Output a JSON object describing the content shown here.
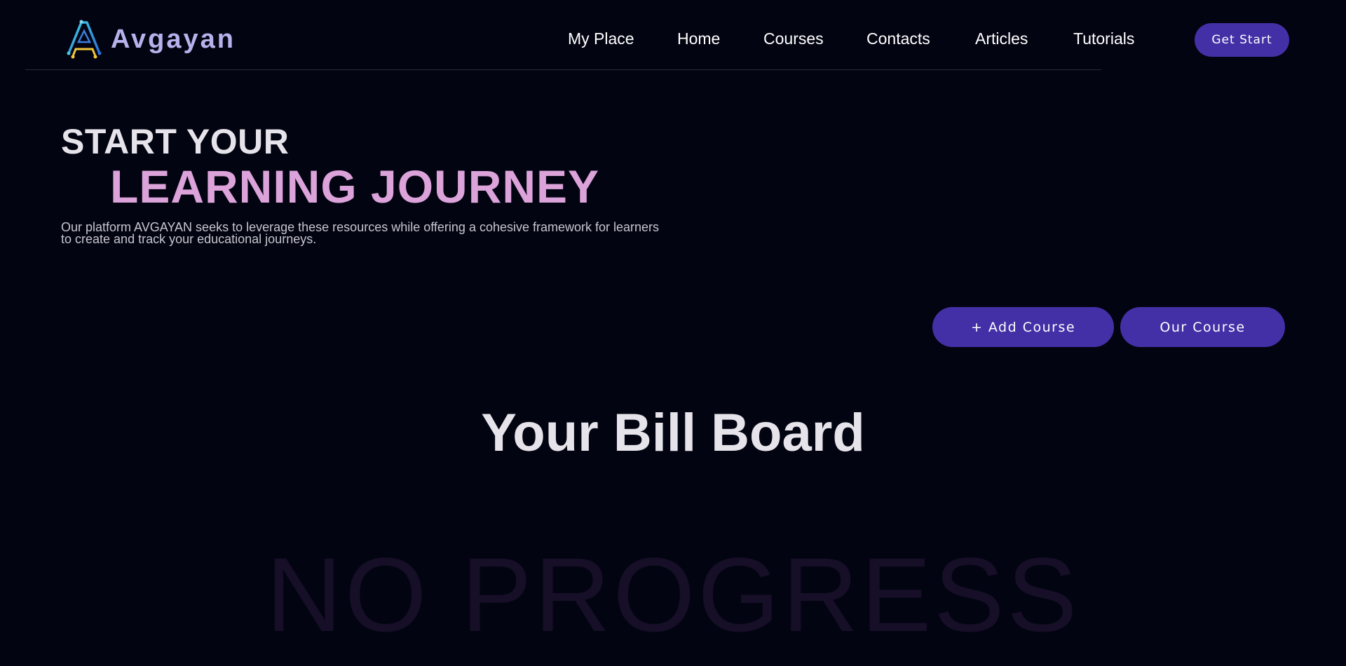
{
  "brand": {
    "name": "Avgayan",
    "logo_icon": "letter-a-circuit-logo-icon"
  },
  "nav": {
    "items": [
      {
        "label": "My Place"
      },
      {
        "label": "Home"
      },
      {
        "label": "Courses"
      },
      {
        "label": "Contacts"
      },
      {
        "label": "Articles"
      },
      {
        "label": "Tutorials"
      }
    ],
    "cta_label": "Get Start"
  },
  "hero": {
    "line1": "START YOUR",
    "line2": "LEARNING JOURNEY",
    "description": "Our platform AVGAYAN seeks to leverage these resources while offering a cohesive framework for learners to create and track your educational journeys."
  },
  "actions": {
    "add_course_label": "+ Add Course",
    "our_course_label": "Our Course"
  },
  "billboard": {
    "title": "Your Bill Board",
    "empty_text": "NO PROGRESS"
  },
  "colors": {
    "background": "#030412",
    "accent": "#4330a6",
    "brand_text": "#b8b2ec",
    "hero_highlight": "#dba3d9"
  }
}
